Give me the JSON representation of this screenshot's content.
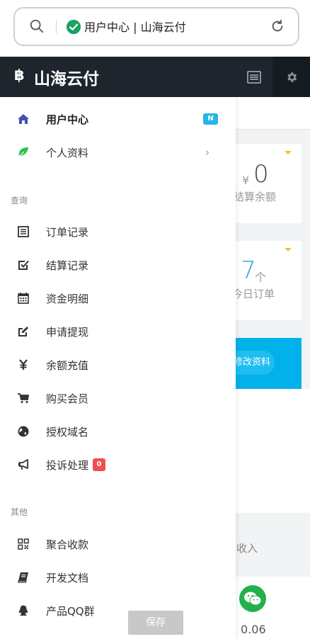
{
  "browser": {
    "url_text": "用户中心 | 山海云付"
  },
  "header": {
    "brand_icon": "฿",
    "brand_name": "山海云付"
  },
  "drawer": {
    "nav_main": [
      {
        "label": "用户中心",
        "icon": "home-icon",
        "badge": "N",
        "active": true
      },
      {
        "label": "个人资料",
        "icon": "leaf-icon",
        "chevron": "›"
      }
    ],
    "section_query": "查询",
    "nav_query": [
      {
        "label": "订单记录",
        "icon": "list-icon"
      },
      {
        "label": "结算记录",
        "icon": "check-square-icon"
      },
      {
        "label": "资金明细",
        "icon": "calendar-icon"
      },
      {
        "label": "申请提现",
        "icon": "edit-icon"
      },
      {
        "label": "余额充值",
        "icon": "yen-icon"
      },
      {
        "label": "购买会员",
        "icon": "cart-icon"
      },
      {
        "label": "授权域名",
        "icon": "globe-icon"
      },
      {
        "label": "投诉处理",
        "icon": "bullhorn-icon",
        "badge": "0"
      }
    ],
    "section_other": "其他",
    "nav_other": [
      {
        "label": "聚合收款",
        "icon": "qrcode-icon"
      },
      {
        "label": "开发文档",
        "icon": "book-icon"
      },
      {
        "label": "产品QQ群",
        "icon": "qq-icon"
      }
    ]
  },
  "main": {
    "balance": {
      "currency": "¥",
      "value": "0",
      "label": "结算余额"
    },
    "orders": {
      "value": "7",
      "unit": "个",
      "label": "今日订单"
    },
    "banner_button": "修改资料",
    "income_label": "收入",
    "wechat_amount": "0.06"
  },
  "save_button": "保存",
  "colors": {
    "header_bg": "#1e252d",
    "accent_blue": "#23b7e5",
    "badge_red": "#f05050",
    "home_icon": "#3f51b5",
    "leaf_icon": "#27c24c"
  }
}
